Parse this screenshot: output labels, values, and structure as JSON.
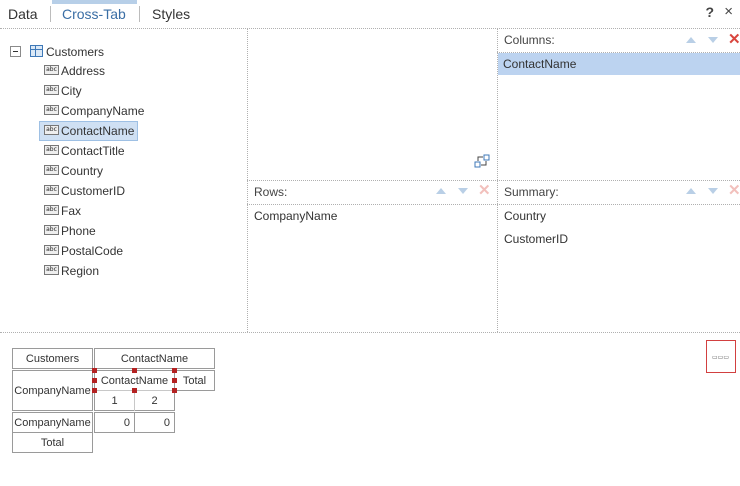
{
  "tabs": {
    "data": "Data",
    "crosstab": "Cross-Tab",
    "styles": "Styles"
  },
  "header": {
    "help": "?",
    "close": "×"
  },
  "tree": {
    "root": "Customers",
    "fields": [
      "Address",
      "City",
      "CompanyName",
      "ContactName",
      "ContactTitle",
      "Country",
      "CustomerID",
      "Fax",
      "Phone",
      "PostalCode",
      "Region"
    ],
    "selected_field": "ContactName",
    "field_icon_text": "abc"
  },
  "columns_panel": {
    "title": "Columns:",
    "items": [
      "ContactName"
    ]
  },
  "rows_panel": {
    "title": "Rows:",
    "items": [
      "CompanyName"
    ]
  },
  "summary_panel": {
    "title": "Summary:",
    "items": [
      "Country",
      "CustomerID"
    ]
  },
  "preview": {
    "header_left": "Customers",
    "header_col": "ContactName",
    "row_label": "CompanyName",
    "inner_col": "ContactName",
    "total": "Total",
    "col1": "1",
    "col2": "2",
    "data_row_label": "CompanyName",
    "val1": "0",
    "val2": "0",
    "total_row": "Total"
  },
  "colors": {
    "accent": "#3a6ea5",
    "selection": "#bcd3f0",
    "delete": "#d9463e"
  }
}
